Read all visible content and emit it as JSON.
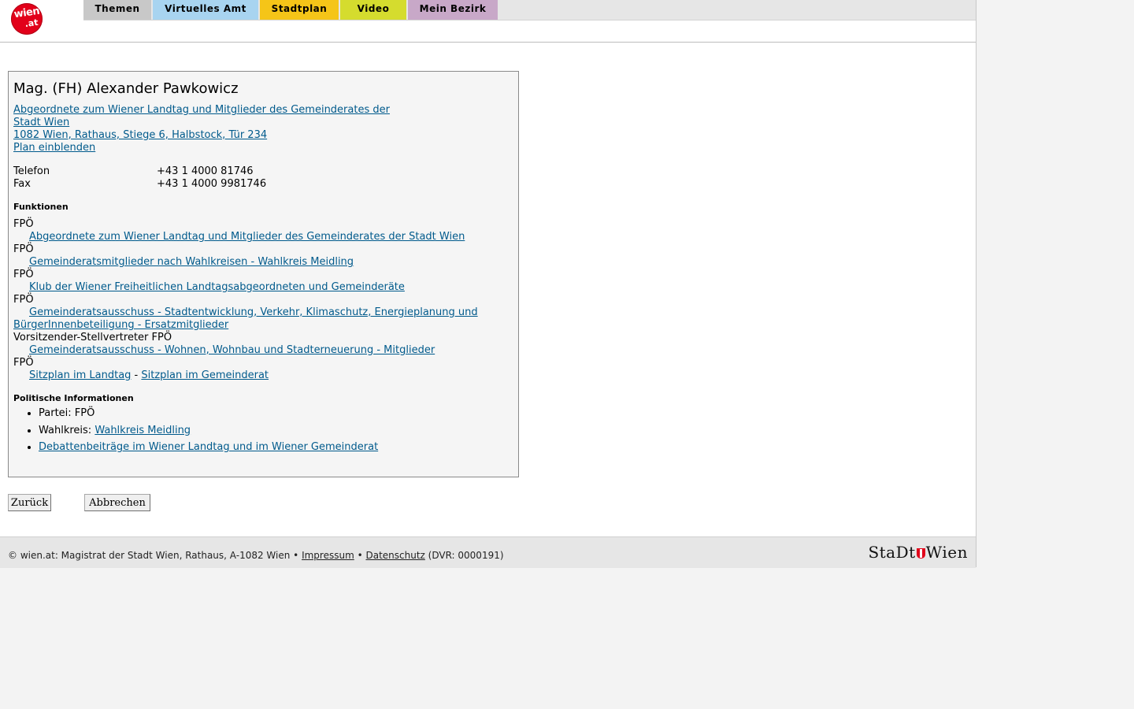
{
  "logo": {
    "line1": "wien",
    "line2": ".at"
  },
  "nav": {
    "tabs": [
      {
        "label": "Themen",
        "color": "#c8c8c8"
      },
      {
        "label": "Virtuelles Amt",
        "color": "#a8d4f0"
      },
      {
        "label": "Stadtplan",
        "color": "#f5c518"
      },
      {
        "label": "Video",
        "color": "#d5dc2e"
      },
      {
        "label": "Mein Bezirk",
        "color": "#c8a8c8"
      }
    ]
  },
  "person": {
    "name": "Mag. (FH) Alexander Pawkowicz",
    "org_line1": "Abgeordnete zum Wiener Landtag und Mitglieder des Gemeinderates der",
    "org_line2": "Stadt Wien ",
    "address": "1082 Wien, Rathaus, Stiege 6, Halbstock, Tür 234",
    "plan_link": "Plan einblenden"
  },
  "contact": {
    "phone_label": "Telefon",
    "phone_value": "+43 1 4000 81746",
    "fax_label": "Fax",
    "fax_value": "+43 1 4000 9981746"
  },
  "functions": {
    "heading": "Funktionen",
    "items": [
      {
        "party": "FPÖ",
        "link": "Abgeordnete zum Wiener Landtag und Mitglieder des Gemeinderates der Stadt Wien"
      },
      {
        "party": "FPÖ",
        "link": "Gemeinderatsmitglieder nach Wahlkreisen - Wahlkreis Meidling"
      },
      {
        "party": "FPÖ",
        "link": "Klub der Wiener Freiheitlichen Landtagsabgeordneten und Gemeinderäte"
      },
      {
        "party": "FPÖ",
        "link": "Gemeinderatsausschuss - Stadtentwicklung, Verkehr, Klimaschutz, Energieplanung und BürgerInnenbeteiligung - Ersatzmitglieder"
      },
      {
        "party": "Vorsitzender-Stellvertreter FPÖ",
        "link": "Gemeinderatsausschuss - Wohnen, Wohnbau und Stadterneuerung - Mitglieder"
      }
    ],
    "last_party": "FPÖ",
    "seat_landtag": "Sitzplan im Landtag",
    "seat_separator": " - ",
    "seat_gemeinderat": "Sitzplan im Gemeinderat"
  },
  "politics": {
    "heading": "Politische Informationen",
    "party_label": "Partei: FPÖ",
    "district_label": "Wahlkreis: ",
    "district_link": "Wahlkreis Meidling",
    "debates_link": "Debattenbeiträge im Wiener Landtag und im Wiener Gemeinderat"
  },
  "buttons": {
    "back": "Zurück",
    "cancel": "Abbrechen"
  },
  "footer": {
    "copyright": "© wien.at: Magistrat der Stadt Wien, Rathaus, A-1082 Wien • ",
    "impressum": "Impressum",
    "sep": " • ",
    "datenschutz": "Datenschutz",
    "dvr": " (DVR: 0000191)",
    "logo_left": "StaDt",
    "logo_right": "Wien"
  }
}
